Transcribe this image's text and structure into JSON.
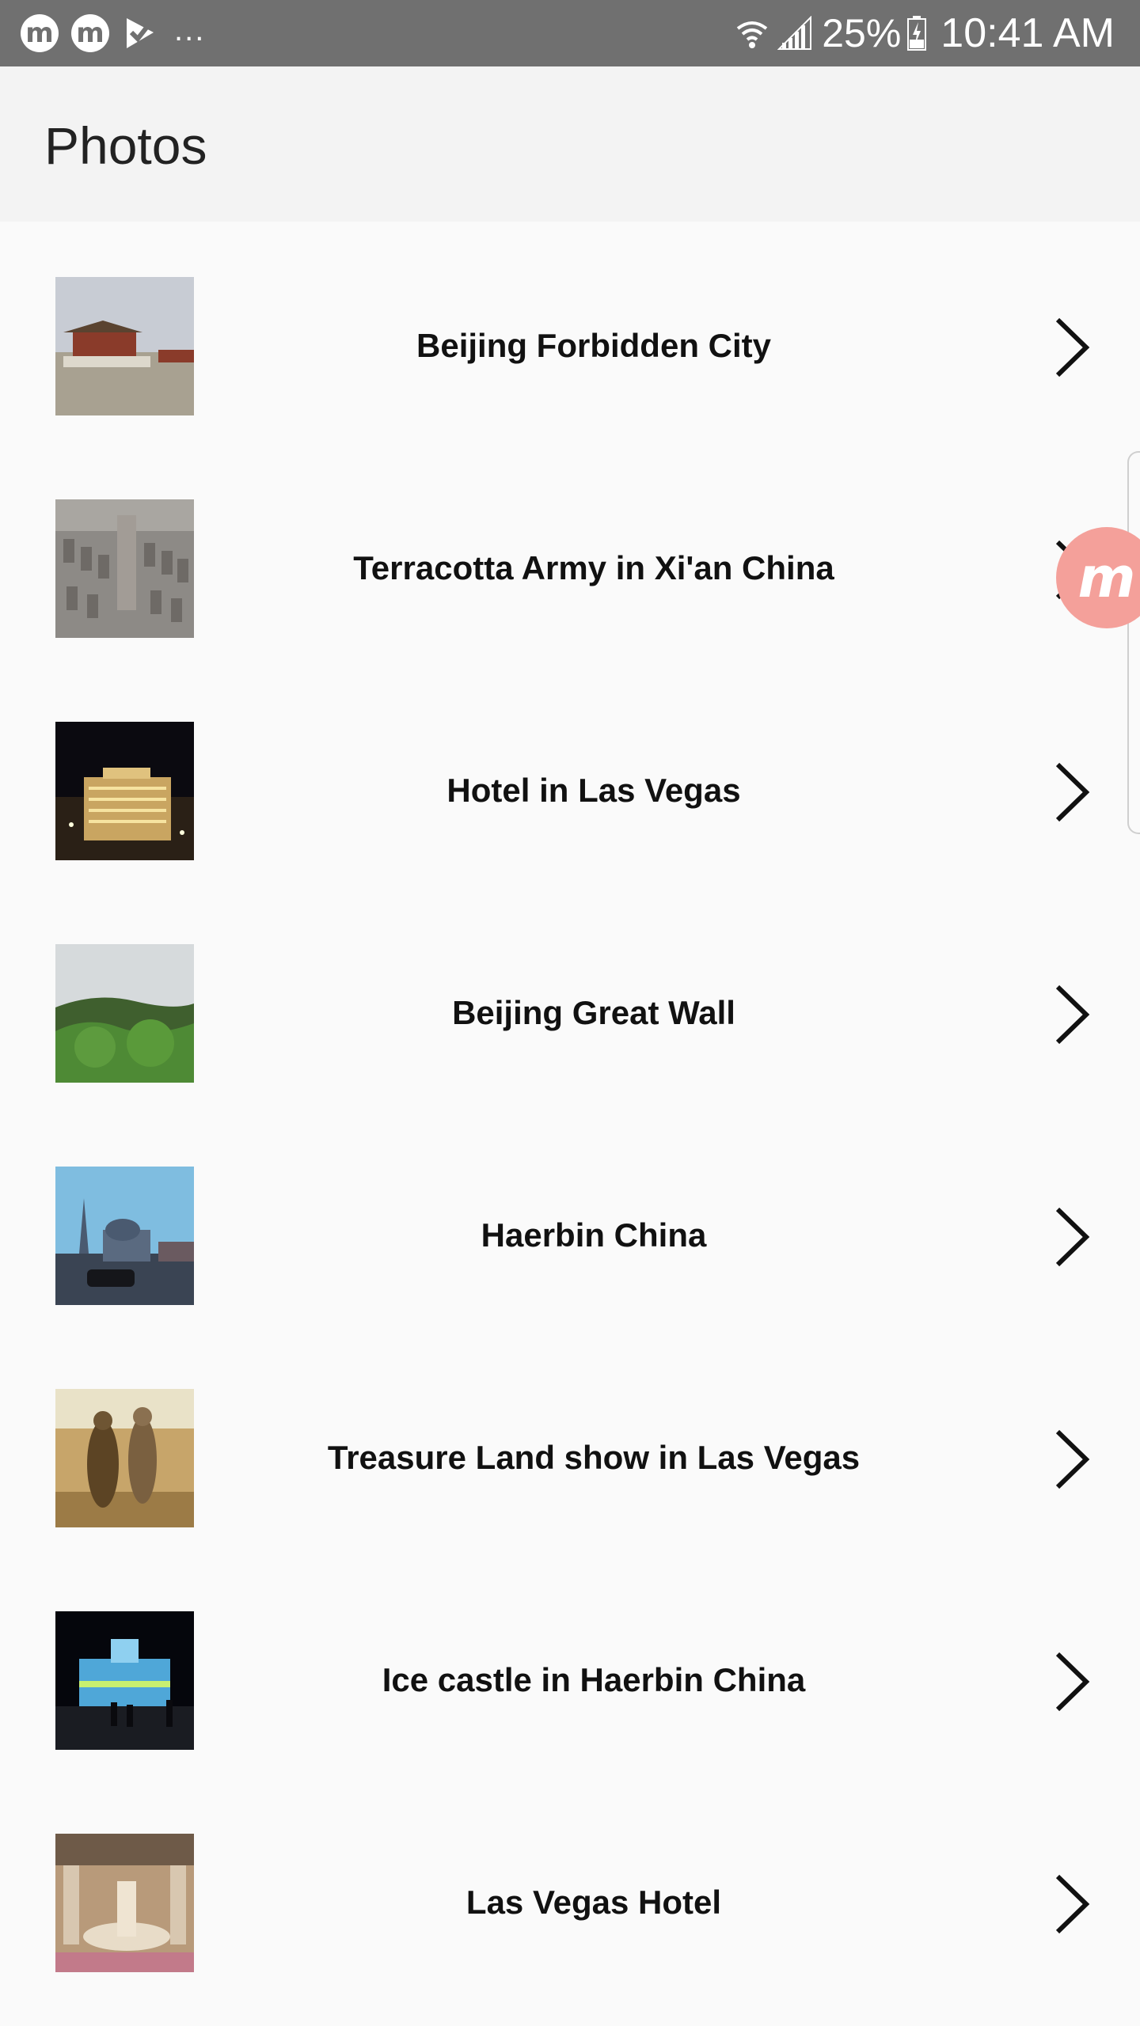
{
  "status_bar": {
    "notification_icons": [
      "messenger-icon",
      "messenger-icon",
      "check-flag-icon"
    ],
    "more": "...",
    "battery_percent": "25%",
    "time": "10:41 AM",
    "background": "#707070"
  },
  "app_bar": {
    "title": "Photos",
    "background": "#f3f3f3"
  },
  "photos": [
    {
      "label": "Beijing Forbidden City"
    },
    {
      "label": "Terracotta Army in Xi'an China"
    },
    {
      "label": "Hotel in Las Vegas"
    },
    {
      "label": "Beijing Great Wall"
    },
    {
      "label": "Haerbin China"
    },
    {
      "label": "Treasure Land show in Las Vegas"
    },
    {
      "label": "Ice castle in Haerbin China"
    },
    {
      "label": "Las Vegas Hotel"
    }
  ],
  "floating_bubble": {
    "glyph": "m",
    "color": "#f4a09a"
  }
}
